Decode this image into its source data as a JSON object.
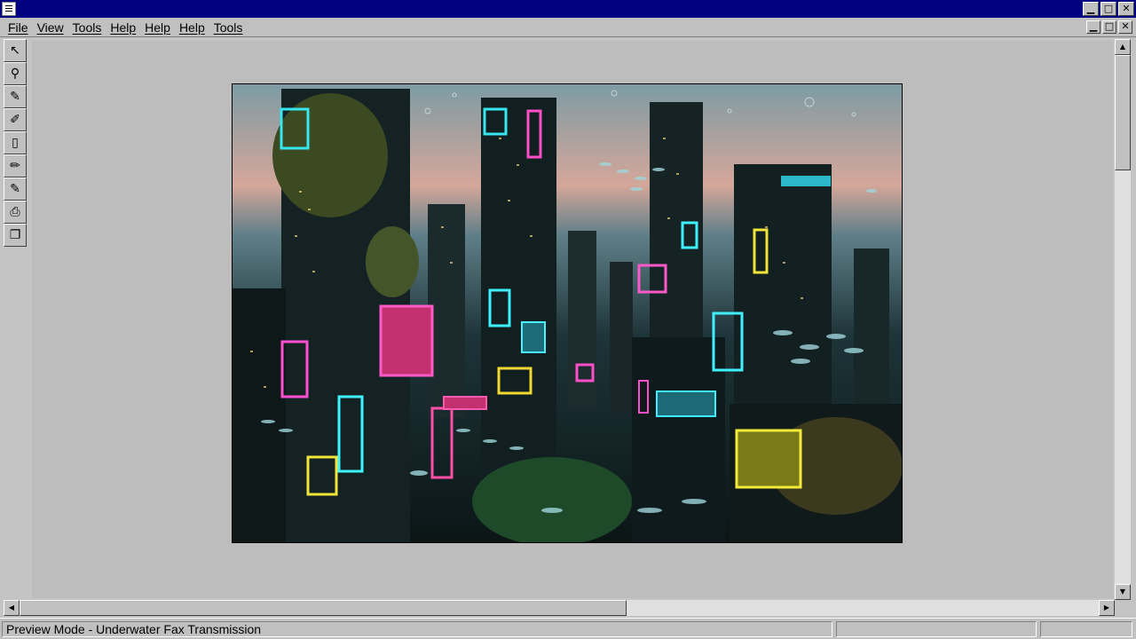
{
  "window": {
    "app_icon": "document-icon",
    "buttons": {
      "minimize": "▁",
      "maximize": "□",
      "close": "✕"
    }
  },
  "menu": {
    "items": [
      "File",
      "View",
      "Tools",
      "Help",
      "Help",
      "Help",
      "Tools"
    ]
  },
  "toolbox": {
    "tools": [
      {
        "icon": "arrow-pointer-icon",
        "glyph": "↖"
      },
      {
        "icon": "magnifier-icon",
        "glyph": "⚲"
      },
      {
        "icon": "pen-icon",
        "glyph": "✎"
      },
      {
        "icon": "highlighter-icon",
        "glyph": "✐"
      },
      {
        "icon": "page-icon",
        "glyph": "▯"
      },
      {
        "icon": "pencil-icon",
        "glyph": "✏"
      },
      {
        "icon": "marker-icon",
        "glyph": "✎"
      },
      {
        "icon": "printer-icon",
        "glyph": "⎙"
      },
      {
        "icon": "copy-pages-icon",
        "glyph": "❐"
      }
    ]
  },
  "image": {
    "subject": "underwater-neon-city-photo"
  },
  "scroll": {
    "up": "▲",
    "down": "▼",
    "left": "◀",
    "right": "▶"
  },
  "status": {
    "text": "Preview Mode - Underwater Fax Transmission"
  }
}
